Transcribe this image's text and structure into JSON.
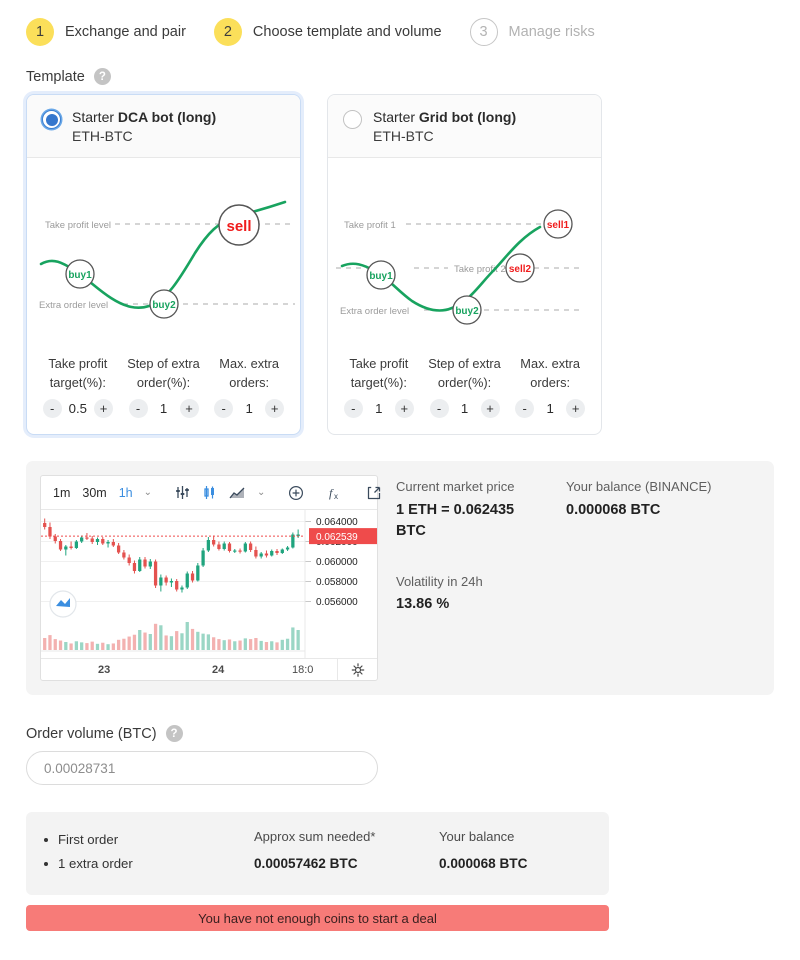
{
  "steps": [
    {
      "num": "1",
      "label": "Exchange and pair",
      "state": "active"
    },
    {
      "num": "2",
      "label": "Choose template and volume",
      "state": "active"
    },
    {
      "num": "3",
      "label": "Manage risks",
      "state": "inactive"
    }
  ],
  "template_section": {
    "label": "Template",
    "help": "?"
  },
  "cards": [
    {
      "selected": true,
      "prefix": "Starter ",
      "name": "DCA bot (long)",
      "pair": "ETH-BTC",
      "graph": {
        "lines": [
          {
            "text": "Take profit level"
          },
          {
            "text": "Extra order level"
          }
        ],
        "nodes": [
          {
            "text": "buy1",
            "kind": "buy"
          },
          {
            "text": "buy2",
            "kind": "buy"
          },
          {
            "text": "sell",
            "kind": "sell"
          }
        ]
      },
      "params": [
        {
          "label": "Take profit target(%):",
          "value": "0.5",
          "minus": "-",
          "plus": "+"
        },
        {
          "label": "Step of extra order(%):",
          "value": "1",
          "minus": "-",
          "plus": "+"
        },
        {
          "label": "Max. extra orders:",
          "value": "1",
          "minus": "-",
          "plus": "+"
        }
      ]
    },
    {
      "selected": false,
      "prefix": "Starter ",
      "name": "Grid bot (long)",
      "pair": "ETH-BTC",
      "graph": {
        "lines": [
          {
            "text": "Take profit 1"
          },
          {
            "text": "Take profit 2"
          },
          {
            "text": "Extra order level"
          }
        ],
        "nodes": [
          {
            "text": "buy1",
            "kind": "buy"
          },
          {
            "text": "buy2",
            "kind": "buy"
          },
          {
            "text": "sell1",
            "kind": "sell"
          },
          {
            "text": "sell2",
            "kind": "sell"
          }
        ]
      },
      "params": [
        {
          "label": "Take profit target(%):",
          "value": "1",
          "minus": "-",
          "plus": "+"
        },
        {
          "label": "Step of extra order(%):",
          "value": "1",
          "minus": "-",
          "plus": "+"
        },
        {
          "label": "Max. extra orders:",
          "value": "1",
          "minus": "-",
          "plus": "+"
        }
      ]
    }
  ],
  "chart": {
    "toolbar": {
      "intervals": [
        {
          "label": "1m",
          "active": false
        },
        {
          "label": "30m",
          "active": false
        },
        {
          "label": "1h",
          "active": true
        }
      ],
      "interval_chevron": "⌄",
      "style_chevron": "⌄",
      "icons": [
        "indicators-icon",
        "candles-icon",
        "line-chart-icon",
        "add-icon",
        "formula-icon",
        "fullscreen-icon"
      ]
    },
    "gear": "settings-icon"
  },
  "chart_data": {
    "type": "candlestick",
    "title": "",
    "xlabel": "",
    "ylabel": "",
    "symbol": "ETH-BTC",
    "interval": "1h",
    "grid": true,
    "ylim": [
      0.05475,
      0.06475
    ],
    "y_ticks": [
      "0.064000",
      "0.062000",
      "0.060000",
      "0.058000",
      "0.056000"
    ],
    "y_tick_values": [
      0.064,
      0.062,
      0.06,
      0.058,
      0.056
    ],
    "x_ticks": [
      "23",
      "24",
      "18:0"
    ],
    "current_price_label": "0.062539",
    "current_price_value": 0.062539,
    "current_price_color": "#ef4b4b",
    "up_color": "#20a47e",
    "down_color": "#e4524f",
    "candles": [
      {
        "o": 0.06385,
        "h": 0.0643,
        "l": 0.0632,
        "c": 0.06345,
        "v": 0.33,
        "dir": "down"
      },
      {
        "o": 0.06345,
        "h": 0.0639,
        "l": 0.06225,
        "c": 0.0625,
        "v": 0.41,
        "dir": "down"
      },
      {
        "o": 0.0625,
        "h": 0.06275,
        "l": 0.0618,
        "c": 0.06205,
        "v": 0.3,
        "dir": "down"
      },
      {
        "o": 0.06205,
        "h": 0.06225,
        "l": 0.06105,
        "c": 0.0612,
        "v": 0.26,
        "dir": "down"
      },
      {
        "o": 0.0612,
        "h": 0.06165,
        "l": 0.0606,
        "c": 0.0615,
        "v": 0.22,
        "dir": "up"
      },
      {
        "o": 0.0615,
        "h": 0.062,
        "l": 0.0612,
        "c": 0.06135,
        "v": 0.18,
        "dir": "down"
      },
      {
        "o": 0.06135,
        "h": 0.06215,
        "l": 0.06125,
        "c": 0.062,
        "v": 0.24,
        "dir": "up"
      },
      {
        "o": 0.062,
        "h": 0.0626,
        "l": 0.06185,
        "c": 0.0624,
        "v": 0.21,
        "dir": "up"
      },
      {
        "o": 0.0624,
        "h": 0.06285,
        "l": 0.06215,
        "c": 0.0623,
        "v": 0.19,
        "dir": "down"
      },
      {
        "o": 0.0623,
        "h": 0.06255,
        "l": 0.06175,
        "c": 0.06195,
        "v": 0.23,
        "dir": "down"
      },
      {
        "o": 0.06195,
        "h": 0.0624,
        "l": 0.06165,
        "c": 0.06225,
        "v": 0.17,
        "dir": "up"
      },
      {
        "o": 0.06225,
        "h": 0.06245,
        "l": 0.06165,
        "c": 0.0618,
        "v": 0.2,
        "dir": "down"
      },
      {
        "o": 0.0618,
        "h": 0.06215,
        "l": 0.0614,
        "c": 0.06195,
        "v": 0.16,
        "dir": "up"
      },
      {
        "o": 0.06195,
        "h": 0.06225,
        "l": 0.06145,
        "c": 0.0616,
        "v": 0.18,
        "dir": "down"
      },
      {
        "o": 0.0616,
        "h": 0.06185,
        "l": 0.06075,
        "c": 0.0609,
        "v": 0.28,
        "dir": "down"
      },
      {
        "o": 0.0609,
        "h": 0.06115,
        "l": 0.0602,
        "c": 0.0604,
        "v": 0.31,
        "dir": "down"
      },
      {
        "o": 0.0604,
        "h": 0.0607,
        "l": 0.0596,
        "c": 0.05985,
        "v": 0.37,
        "dir": "down"
      },
      {
        "o": 0.05985,
        "h": 0.0601,
        "l": 0.0588,
        "c": 0.05905,
        "v": 0.42,
        "dir": "down"
      },
      {
        "o": 0.05905,
        "h": 0.06045,
        "l": 0.05895,
        "c": 0.0602,
        "v": 0.55,
        "dir": "up"
      },
      {
        "o": 0.0602,
        "h": 0.06045,
        "l": 0.0593,
        "c": 0.0595,
        "v": 0.48,
        "dir": "down"
      },
      {
        "o": 0.0595,
        "h": 0.06025,
        "l": 0.05925,
        "c": 0.06,
        "v": 0.44,
        "dir": "up"
      },
      {
        "o": 0.06,
        "h": 0.0602,
        "l": 0.05735,
        "c": 0.0576,
        "v": 0.72,
        "dir": "down"
      },
      {
        "o": 0.0576,
        "h": 0.0587,
        "l": 0.057,
        "c": 0.0584,
        "v": 0.68,
        "dir": "up"
      },
      {
        "o": 0.0584,
        "h": 0.0586,
        "l": 0.0576,
        "c": 0.0579,
        "v": 0.4,
        "dir": "down"
      },
      {
        "o": 0.0579,
        "h": 0.0583,
        "l": 0.05745,
        "c": 0.05805,
        "v": 0.38,
        "dir": "up"
      },
      {
        "o": 0.05805,
        "h": 0.05825,
        "l": 0.057,
        "c": 0.0572,
        "v": 0.52,
        "dir": "down"
      },
      {
        "o": 0.0572,
        "h": 0.0576,
        "l": 0.0569,
        "c": 0.0574,
        "v": 0.46,
        "dir": "up"
      },
      {
        "o": 0.0574,
        "h": 0.059,
        "l": 0.05725,
        "c": 0.0588,
        "v": 0.77,
        "dir": "up"
      },
      {
        "o": 0.0588,
        "h": 0.05905,
        "l": 0.0579,
        "c": 0.0581,
        "v": 0.58,
        "dir": "down"
      },
      {
        "o": 0.0581,
        "h": 0.05985,
        "l": 0.058,
        "c": 0.0596,
        "v": 0.5,
        "dir": "up"
      },
      {
        "o": 0.0596,
        "h": 0.06135,
        "l": 0.05945,
        "c": 0.0611,
        "v": 0.45,
        "dir": "up"
      },
      {
        "o": 0.0611,
        "h": 0.06245,
        "l": 0.06095,
        "c": 0.06215,
        "v": 0.43,
        "dir": "up"
      },
      {
        "o": 0.06215,
        "h": 0.0626,
        "l": 0.0615,
        "c": 0.0617,
        "v": 0.35,
        "dir": "down"
      },
      {
        "o": 0.0617,
        "h": 0.062,
        "l": 0.0611,
        "c": 0.06125,
        "v": 0.3,
        "dir": "down"
      },
      {
        "o": 0.06125,
        "h": 0.062,
        "l": 0.0611,
        "c": 0.0618,
        "v": 0.27,
        "dir": "up"
      },
      {
        "o": 0.0618,
        "h": 0.06195,
        "l": 0.0609,
        "c": 0.06105,
        "v": 0.29,
        "dir": "down"
      },
      {
        "o": 0.06105,
        "h": 0.06125,
        "l": 0.06085,
        "c": 0.0611,
        "v": 0.24,
        "dir": "up"
      },
      {
        "o": 0.0611,
        "h": 0.0613,
        "l": 0.0608,
        "c": 0.061,
        "v": 0.26,
        "dir": "down"
      },
      {
        "o": 0.061,
        "h": 0.06195,
        "l": 0.0609,
        "c": 0.0618,
        "v": 0.32,
        "dir": "up"
      },
      {
        "o": 0.0618,
        "h": 0.062,
        "l": 0.06095,
        "c": 0.06115,
        "v": 0.3,
        "dir": "down"
      },
      {
        "o": 0.06115,
        "h": 0.0615,
        "l": 0.0603,
        "c": 0.0605,
        "v": 0.33,
        "dir": "down"
      },
      {
        "o": 0.0605,
        "h": 0.06095,
        "l": 0.0603,
        "c": 0.0608,
        "v": 0.25,
        "dir": "up"
      },
      {
        "o": 0.0608,
        "h": 0.0611,
        "l": 0.0604,
        "c": 0.0606,
        "v": 0.22,
        "dir": "down"
      },
      {
        "o": 0.0606,
        "h": 0.0612,
        "l": 0.0605,
        "c": 0.06105,
        "v": 0.24,
        "dir": "up"
      },
      {
        "o": 0.06105,
        "h": 0.06125,
        "l": 0.06065,
        "c": 0.06085,
        "v": 0.21,
        "dir": "down"
      },
      {
        "o": 0.06085,
        "h": 0.0613,
        "l": 0.06075,
        "c": 0.0612,
        "v": 0.28,
        "dir": "up"
      },
      {
        "o": 0.0612,
        "h": 0.06155,
        "l": 0.06105,
        "c": 0.0614,
        "v": 0.31,
        "dir": "up"
      },
      {
        "o": 0.0614,
        "h": 0.0629,
        "l": 0.0613,
        "c": 0.0627,
        "v": 0.62,
        "dir": "up"
      },
      {
        "o": 0.0627,
        "h": 0.0632,
        "l": 0.06235,
        "c": 0.06254,
        "v": 0.55,
        "dir": "up"
      }
    ]
  },
  "market": {
    "price_label": "Current market price",
    "price_value": "1 ETH = 0.062435 BTC",
    "balance_label": "Your balance (BINANCE)",
    "balance_value": "0.000068 BTC",
    "volatility_label": "Volatility in 24h",
    "volatility_value": "13.86 %"
  },
  "order_volume": {
    "label": "Order volume (BTC)",
    "help": "?",
    "value": "0.00028731",
    "placeholder": "0.00028731"
  },
  "summary": {
    "orders": [
      "First order",
      "1 extra order"
    ],
    "approx_label": "Approx sum needed*",
    "approx_value": "0.00057462 BTC",
    "balance_label": "Your balance",
    "balance_value": "0.000068 BTC"
  },
  "alert": {
    "text": "You have not enough coins to start a deal",
    "color": "#f77b78"
  }
}
